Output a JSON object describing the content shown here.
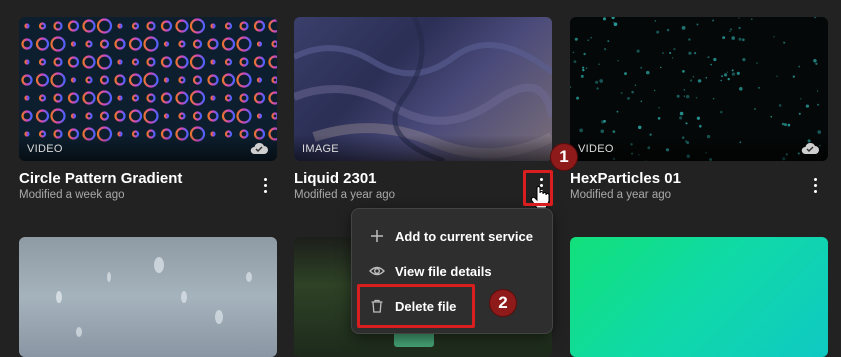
{
  "cards": [
    {
      "type_label": "VIDEO",
      "title": "Circle Pattern Gradient",
      "modified": "Modified a week ago"
    },
    {
      "type_label": "IMAGE",
      "title": "Liquid 2301",
      "modified": "Modified a year ago"
    },
    {
      "type_label": "VIDEO",
      "title": "HexParticles 01",
      "modified": "Modified a year ago"
    }
  ],
  "context_menu": {
    "items": [
      {
        "label": "Add to current service",
        "icon": "plus-icon"
      },
      {
        "label": "View file details",
        "icon": "eye-icon"
      },
      {
        "label": "Delete file",
        "icon": "trash-icon"
      }
    ]
  },
  "annotations": {
    "step1": "1",
    "step2": "2"
  },
  "colors": {
    "background": "#222222",
    "highlight": "#d81e1e",
    "badge": "#8f1a1a"
  }
}
